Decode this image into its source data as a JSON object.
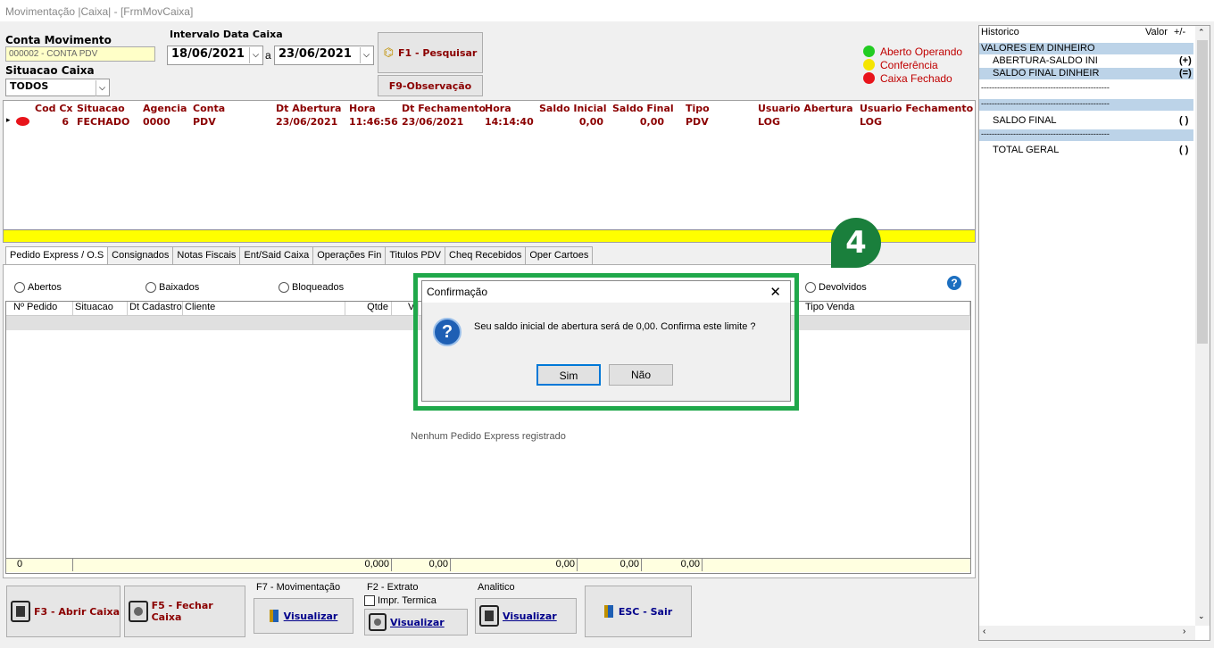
{
  "window": {
    "title": "Movimentação |Caixa| - [FrmMovCaixa]"
  },
  "filter": {
    "conta_label": "Conta Movimento",
    "conta_value": "000002 - CONTA PDV",
    "situacao_label": "Situacao Caixa",
    "situacao_value": "TODOS",
    "intervalo_label": "Intervalo Data Caixa",
    "date_from": "18/06/2021",
    "date_sep": "a",
    "date_to": "23/06/2021",
    "search_button": "F1 - Pesquisar",
    "obs_button": "F9-Observação"
  },
  "legend": [
    {
      "label": "Aberto Operando",
      "color": "#22cc22"
    },
    {
      "label": "Conferência",
      "color": "#f5e500"
    },
    {
      "label": "Caixa Fechado",
      "color": "#e8141b"
    }
  ],
  "grid": {
    "headers": [
      "Cod Cx",
      "Situacao",
      "Agencia",
      "Conta",
      "Dt Abertura",
      "Hora",
      "Dt Fechamento",
      "Hora",
      "Saldo Inicial",
      "Saldo Final",
      "Tipo",
      "Usuario Abertura",
      "Usuario Fechamento"
    ],
    "row": [
      "6",
      "FECHADO",
      "0000",
      "PDV",
      "23/06/2021",
      "11:46:56",
      "23/06/2021",
      "14:14:40",
      "0,00",
      "0,00",
      "PDV",
      "LOG",
      "LOG"
    ]
  },
  "tabs": [
    "Pedido Express / O.S",
    "Consignados",
    "Notas Fiscais",
    "Ent/Said Caixa",
    "Operações Fin",
    "Titulos PDV",
    "Cheq Recebidos",
    "Oper Cartoes"
  ],
  "radios": {
    "abertos": "Abertos",
    "baixados": "Baixados",
    "bloqueados": "Bloqueados",
    "devolvidos": "Devolvidos"
  },
  "subgrid": {
    "headers": {
      "pedido": "Nº Pedido",
      "situacao": "Situacao",
      "cadastro": "Dt Cadastro",
      "cliente": "Cliente",
      "qtde": "Qtde",
      "v": "V",
      "tipo_venda": "Tipo Venda"
    },
    "empty": "Nenhum Pedido Express registrado",
    "totals": [
      "0",
      "0,000",
      "0,00",
      "0,00",
      "0,00",
      "0,00"
    ]
  },
  "bottom": {
    "abrir": "F3 - Abrir Caixa",
    "fechar": "F5 - Fechar Caixa",
    "mov_label": "F7 - Movimentação",
    "extrato_label": "F2 - Extrato",
    "impr_termica": "Impr. Termica",
    "analitico_label": "Analitico",
    "visualizar": "Visualizar",
    "sair": "ESC - Sair"
  },
  "right": {
    "h_hist": "Historico",
    "h_valor": "Valor",
    "h_sign": "+/-",
    "rows": [
      {
        "label": "VALORES EM DINHEIRO",
        "sign": ""
      },
      {
        "label": "ABERTURA-SALDO INI",
        "sign": "(+)"
      },
      {
        "label": "SALDO FINAL DINHEIR",
        "sign": "(=)"
      },
      {
        "label": "------------------------------------------------",
        "sign": ""
      },
      {
        "label": "------------------------------------------------",
        "sign": ""
      },
      {
        "label": "SALDO FINAL",
        "sign": "( )"
      },
      {
        "label": "------------------------------------------------",
        "sign": ""
      },
      {
        "label": "TOTAL GERAL",
        "sign": "( )"
      }
    ]
  },
  "dialog": {
    "title": "Confirmação",
    "message": "Seu saldo inicial de abertura será de 0,00. Confirma este limite ?",
    "yes": "Sim",
    "no": "Não",
    "step": "4"
  }
}
